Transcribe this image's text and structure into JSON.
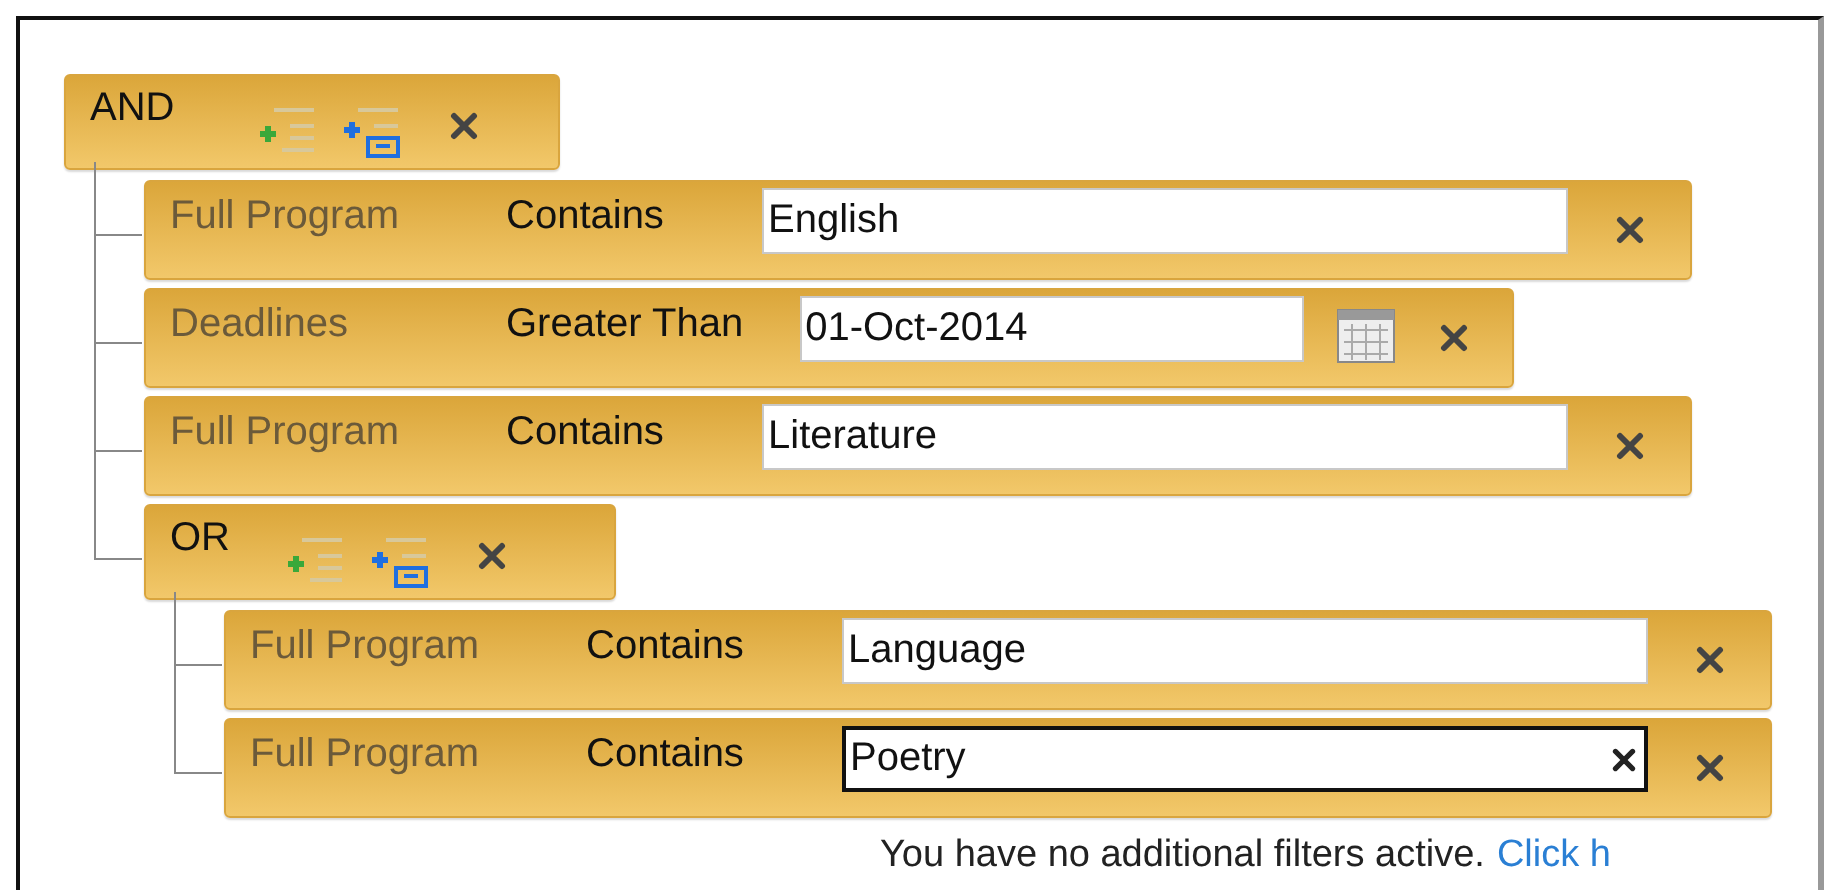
{
  "filter": {
    "kind": "group",
    "operator": "AND",
    "children": [
      {
        "kind": "text_condition",
        "field": "Full Program",
        "operator": "Contains",
        "value": "English",
        "focused": false
      },
      {
        "kind": "date_condition",
        "field": "Deadlines",
        "operator": "Greater Than",
        "value": "01-Oct-2014",
        "focused": false
      },
      {
        "kind": "text_condition",
        "field": "Full Program",
        "operator": "Contains",
        "value": "Literature",
        "focused": false
      },
      {
        "kind": "group",
        "operator": "OR",
        "children": [
          {
            "kind": "text_condition",
            "field": "Full Program",
            "operator": "Contains",
            "value": "Language",
            "focused": false
          },
          {
            "kind": "text_condition",
            "field": "Full Program",
            "operator": "Contains",
            "value": "Poetry",
            "focused": true
          }
        ]
      }
    ]
  },
  "footer": {
    "message": "You have no additional filters active.",
    "link": "Click h"
  }
}
